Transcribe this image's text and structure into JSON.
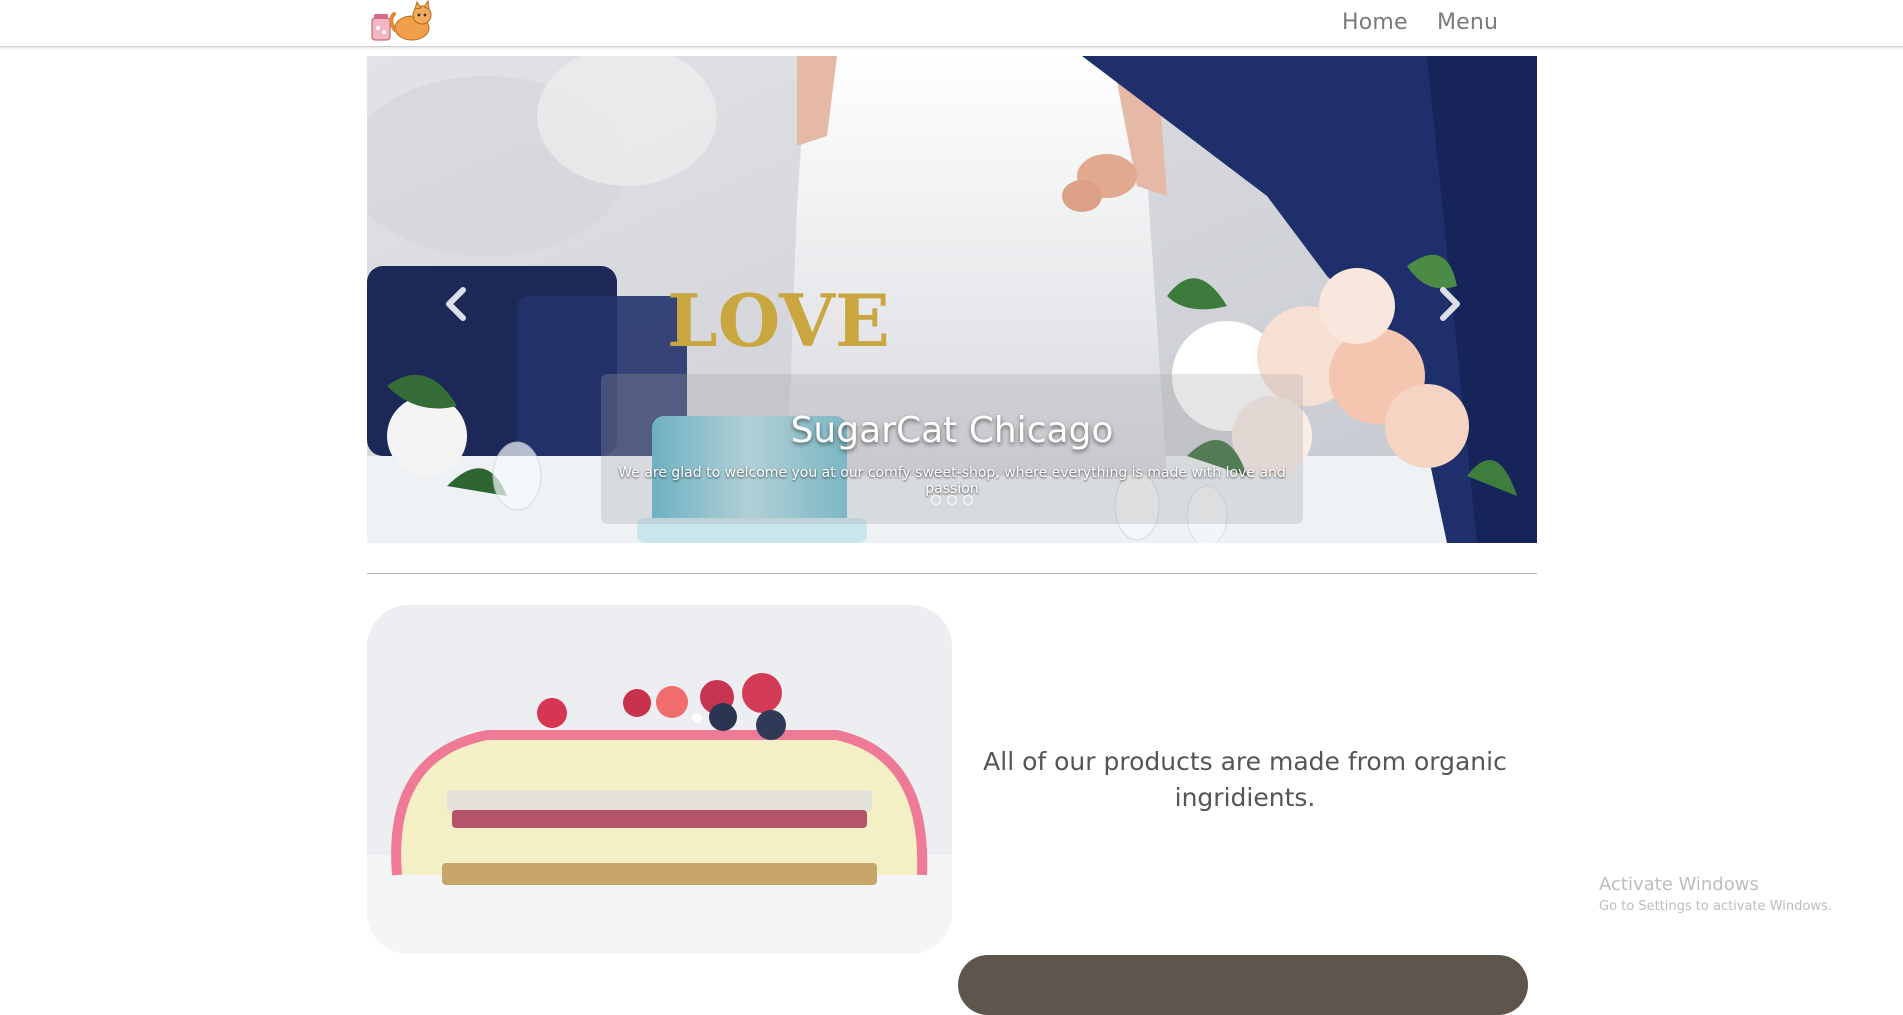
{
  "navbar": {
    "logo_name": "sugarcat-logo",
    "links": [
      "Home",
      "Menu"
    ]
  },
  "carousel": {
    "title": "SugarCat Chicago",
    "text": "We are glad to welcome you at our comfy sweet-shop, where everything is made with love and passion",
    "slide_count": 3,
    "active_index": 0,
    "topper_text": "LOVE"
  },
  "feature": {
    "text": "All of our products are made from organic ingridients."
  },
  "watermark": {
    "title": "Activate Windows",
    "subtitle": "Go to Settings to activate Windows."
  },
  "colors": {
    "nav_text": "#7a7a7a",
    "suit_navy": "#1f2f6b",
    "frosting_pink": "#ee7a95",
    "cake_blue": "#7fc7d6"
  }
}
